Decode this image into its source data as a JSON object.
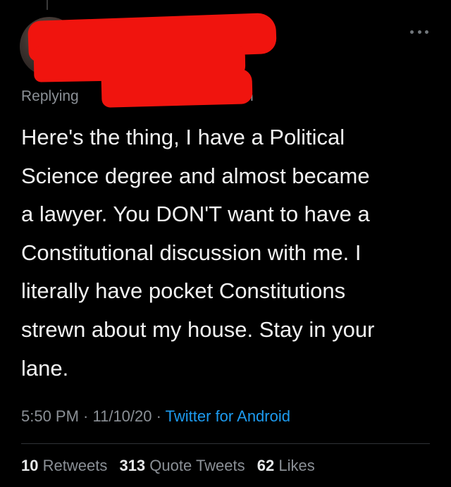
{
  "reply_context": {
    "prefix": "Replying",
    "suffix": "n"
  },
  "tweet": {
    "text": "Here's the thing, I have a Political\nScience degree and almost became\na lawyer. You DON'T want to have a\nConstitutional discussion with me. I\nliterally have pocket Constitutions\nstrewn about my house. Stay in your\nlane."
  },
  "meta": {
    "time": "5:50 PM",
    "separator": " · ",
    "date": "11/10/20",
    "source": "Twitter for Android"
  },
  "stats": {
    "retweets_count": "10",
    "retweets_label": "Retweets",
    "quotes_count": "313",
    "quotes_label": "Quote Tweets",
    "likes_count": "62",
    "likes_label": "Likes"
  },
  "colors": {
    "background": "#000000",
    "text": "#f1f1f1",
    "muted": "#8b9096",
    "link": "#1d9bf0",
    "redaction": "#f0140e"
  },
  "icons": {
    "more": "more-horizontal-icon"
  }
}
